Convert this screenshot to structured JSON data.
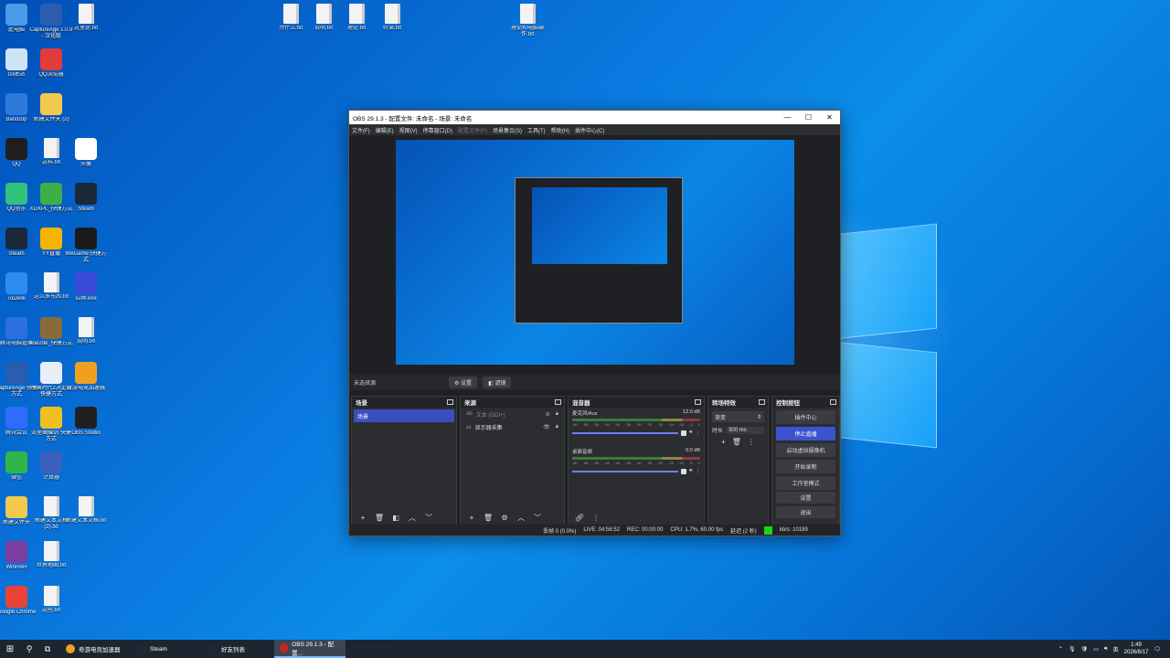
{
  "desktop_icons": [
    {
      "label": "此电脑",
      "kind": "pc",
      "color": "#4a9ae8"
    },
    {
      "label": "CaptureAge 1.0.9 - 汉化版",
      "kind": "app",
      "color": "#2a5db0"
    },
    {
      "label": "这里是.txt",
      "kind": "file"
    },
    {
      "label": "回收站",
      "kind": "bin",
      "color": "#cfe3f7"
    },
    {
      "label": "QQ浏览器",
      "kind": "app",
      "color": "#e23b3b"
    },
    {
      "label": "Bandizip",
      "kind": "app",
      "color": "#2c7bd8"
    },
    {
      "label": "新建文件夹 (2)",
      "kind": "folder",
      "color": "#f2c94c"
    },
    {
      "label": "QQ",
      "kind": "app",
      "color": "#1e1e1e"
    },
    {
      "label": "这样.txt",
      "kind": "file"
    },
    {
      "label": "头像",
      "kind": "app",
      "color": "#ffffff"
    },
    {
      "label": "QQ音乐",
      "kind": "app",
      "color": "#31c27c"
    },
    {
      "label": "XDXPL_快捷方式",
      "kind": "app",
      "color": "#3fae48"
    },
    {
      "label": "Steam",
      "kind": "app",
      "color": "#1b2838"
    },
    {
      "label": "Steam",
      "kind": "app",
      "color": "#1b2838"
    },
    {
      "label": "YY直播",
      "kind": "app",
      "color": "#f4b400"
    },
    {
      "label": "WeGame 快捷方式",
      "kind": "app",
      "color": "#1a1a1a"
    },
    {
      "label": "ToDesk",
      "kind": "app",
      "color": "#2d8cf0"
    },
    {
      "label": "这么多东西.txt",
      "kind": "file"
    },
    {
      "label": "召唤.exe",
      "kind": "app",
      "color": "#3a4ad8"
    },
    {
      "label": "腾讯电脑管家",
      "kind": "app",
      "color": "#2c6fe0"
    },
    {
      "label": "aoe2de_快捷方式",
      "kind": "app",
      "color": "#8a6a3a"
    },
    {
      "label": "说明.txt",
      "kind": "file"
    },
    {
      "label": "CaptureAge 快捷方式",
      "kind": "app",
      "color": "#2a5db0"
    },
    {
      "label": "帝国时代2决定版 快捷方式",
      "kind": "app",
      "color": "#e8eef7"
    },
    {
      "label": "奇游电竞加速器",
      "kind": "app",
      "color": "#f0a020"
    },
    {
      "label": "腾讯会议",
      "kind": "app",
      "color": "#2f6bff"
    },
    {
      "label": "流星蝴蝶剑 快捷方式",
      "kind": "app",
      "color": "#f0c020"
    },
    {
      "label": "OBS Studio",
      "kind": "app",
      "color": "#202020"
    },
    {
      "label": "微信",
      "kind": "app",
      "color": "#2fb64b"
    },
    {
      "label": "计算器",
      "kind": "app",
      "color": "#3a5fbf"
    },
    {
      "label": "新建文件夹",
      "kind": "folder",
      "color": "#f2c94c"
    },
    {
      "label": "新建文本文档 (2).txt",
      "kind": "file"
    },
    {
      "label": "新建文本文档.txt",
      "kind": "file"
    },
    {
      "label": "WinRAR",
      "kind": "app",
      "color": "#7a3fa0"
    },
    {
      "label": "世界地图.txt",
      "kind": "file"
    },
    {
      "label": "Google Chrome",
      "kind": "app",
      "color": "#ea4335"
    },
    {
      "label": "这些.txt",
      "kind": "file"
    }
  ],
  "top_files": [
    {
      "label": "为什么.txt"
    },
    {
      "label": "说明.txt"
    },
    {
      "label": "理论.txt"
    },
    {
      "label": "好读.txt"
    },
    {
      "label": "理论和电脑操作.txt"
    }
  ],
  "obs": {
    "title": "OBS 29.1.3 - 配置文件: 未命名 - 场景: 未命名",
    "title_buttons": {
      "min": "—",
      "max": "☐",
      "close": "✕"
    },
    "menu": [
      {
        "label": "文件(F)",
        "disabled": false
      },
      {
        "label": "编辑(E)",
        "disabled": false
      },
      {
        "label": "视图(V)",
        "disabled": false
      },
      {
        "label": "停靠窗口(D)",
        "disabled": false
      },
      {
        "label": "配置文件(P)",
        "disabled": true
      },
      {
        "label": "场景集合(S)",
        "disabled": false
      },
      {
        "label": "工具(T)",
        "disabled": false
      },
      {
        "label": "帮助(H)",
        "disabled": false
      },
      {
        "label": "插件中心(C)",
        "disabled": false
      }
    ],
    "source_bar": {
      "label": "未选择源",
      "properties": "⚙ 设置",
      "filters": "◧ 滤镜"
    },
    "docks": {
      "scenes": {
        "title": "场景",
        "items": [
          "场景"
        ]
      },
      "sources": {
        "title": "来源",
        "items": [
          {
            "label": "文本 (GDI+)",
            "dim": true,
            "icon": "ab"
          },
          {
            "label": "显示器采集",
            "dim": false,
            "icon": "▭"
          }
        ]
      },
      "mixer": {
        "title": "混音器",
        "channels": [
          {
            "name": "麦克风/Aux",
            "db": "12.0 dB",
            "scale": [
              "-60",
              "-55",
              "-50",
              "-45",
              "-40",
              "-35",
              "-30",
              "-25",
              "-20",
              "-15",
              "-10",
              "-5",
              "0"
            ],
            "level": 0.9
          },
          {
            "name": "桌面音频",
            "db": "0.0 dB",
            "scale": [
              "-60",
              "-55",
              "-50",
              "-45",
              "-40",
              "-35",
              "-30",
              "-25",
              "-20",
              "-15",
              "-10",
              "-5",
              "0"
            ],
            "level": 0.9
          }
        ]
      },
      "transitions": {
        "title": "转场特效",
        "type": "渐变",
        "duration_label": "时长",
        "duration": "300 ms"
      },
      "controls": {
        "title": "控制按钮",
        "buttons": [
          "插件中心",
          "停止直播",
          "启动虚拟摄像机",
          "开始录制",
          "工作室模式",
          "设置",
          "退出"
        ]
      }
    },
    "status": {
      "dropped": "丢帧 0 (0.0%)",
      "live": "LIVE: 04:56:52",
      "rec": "REC: 00:00:00",
      "cpu": "CPU: 1.7%, 60.00 fps",
      "delay": "延迟 (2 秒)",
      "kbs": "kb/s: 10189"
    }
  },
  "taskbar": {
    "apps": [
      {
        "label": "奇游电竞加速器",
        "color": "#f0a020",
        "active": false
      },
      {
        "label": "Steam",
        "color": "#1b2838",
        "active": false
      },
      {
        "label": "好友列表",
        "color": "#1b2838",
        "active": false
      },
      {
        "label": "OBS 29.1.3 - 配置...",
        "color": "#cc2222",
        "active": true
      }
    ],
    "ime": "英",
    "time": "1:49",
    "date": "2026/8/17"
  }
}
